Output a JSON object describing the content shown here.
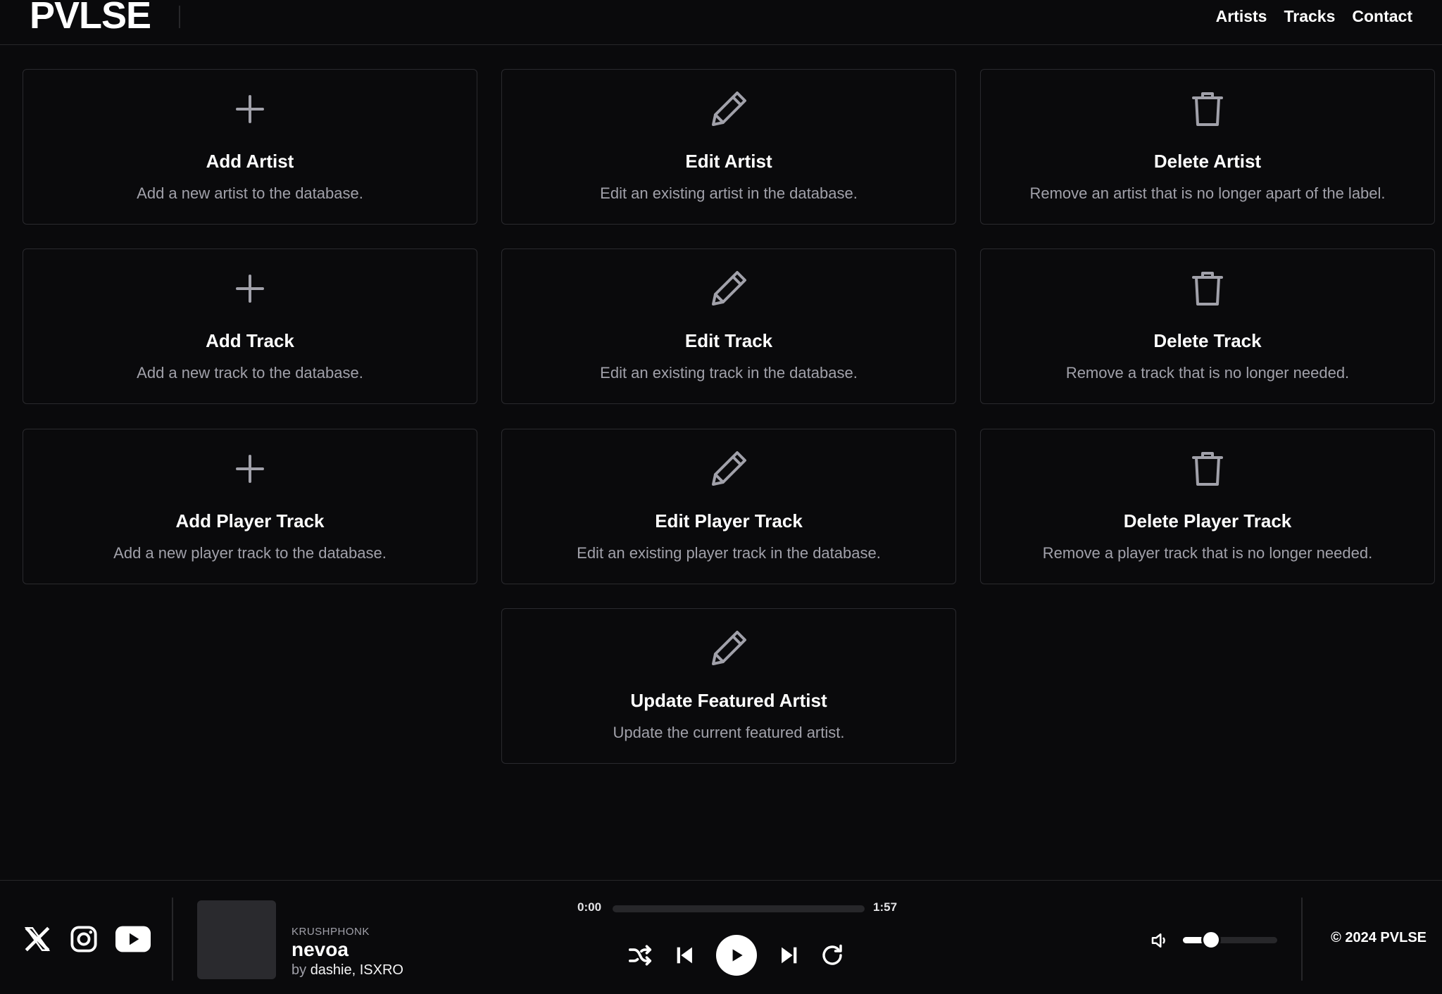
{
  "header": {
    "logo": "PVLSE",
    "nav": [
      "Artists",
      "Tracks",
      "Contact"
    ]
  },
  "cards": [
    {
      "icon": "plus-icon",
      "title": "Add Artist",
      "desc": "Add a new artist to the database."
    },
    {
      "icon": "pencil-icon",
      "title": "Edit Artist",
      "desc": "Edit an existing artist in the database."
    },
    {
      "icon": "trash-icon",
      "title": "Delete Artist",
      "desc": "Remove an artist that is no longer apart of the label."
    },
    {
      "icon": "plus-icon",
      "title": "Add Track",
      "desc": "Add a new track to the database."
    },
    {
      "icon": "pencil-icon",
      "title": "Edit Track",
      "desc": "Edit an existing track in the database."
    },
    {
      "icon": "trash-icon",
      "title": "Delete Track",
      "desc": "Remove a track that is no longer needed."
    },
    {
      "icon": "plus-icon",
      "title": "Add Player Track",
      "desc": "Add a new player track to the database."
    },
    {
      "icon": "pencil-icon",
      "title": "Edit Player Track",
      "desc": "Edit an existing player track in the database."
    },
    {
      "icon": "trash-icon",
      "title": "Delete Player Track",
      "desc": "Remove a player track that is no longer needed."
    },
    {
      "icon": "pencil-icon",
      "title": "Update Featured Artist",
      "desc": "Update the current featured artist."
    }
  ],
  "player": {
    "socials": [
      "x-icon",
      "instagram-icon",
      "youtube-icon"
    ],
    "label": "KRUSHPHONK",
    "title": "nevoa",
    "by_prefix": "by",
    "artists": "dashie, ISXRO",
    "current_time": "0:00",
    "duration": "1:57",
    "progress": 0,
    "volume": 0.3,
    "copyright": "© 2024 PVLSE"
  },
  "colors": {
    "background": "#0a0a0c",
    "border": "#2a2a2e",
    "muted_text": "#a1a1aa",
    "icon": "#a1a1aa"
  }
}
